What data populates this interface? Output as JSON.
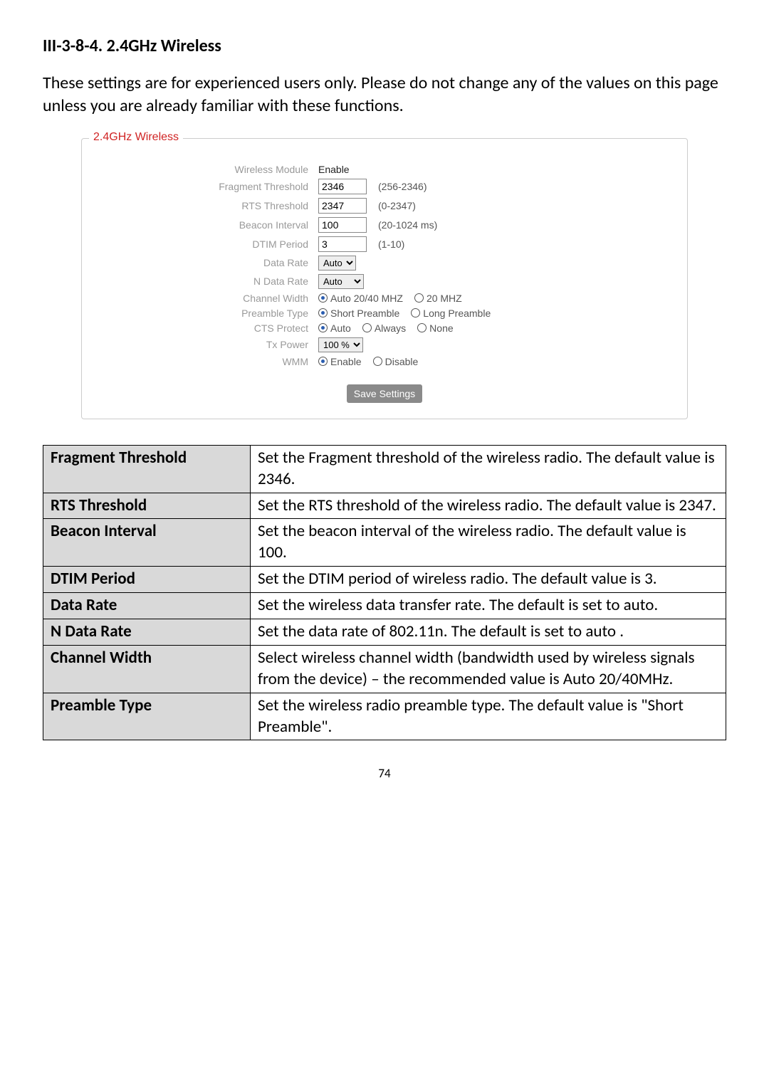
{
  "section_title": "III-3-8-4.    2.4GHz Wireless",
  "intro_text": "These settings are for experienced users only. Please do not change any of the values on this page unless you are already familiar with these functions.",
  "legend": "2.4GHz Wireless",
  "fields": {
    "wireless_module": {
      "label": "Wireless Module",
      "value": "Enable"
    },
    "fragment_threshold": {
      "label": "Fragment Threshold",
      "value": "2346",
      "range": "(256-2346)"
    },
    "rts_threshold": {
      "label": "RTS Threshold",
      "value": "2347",
      "range": "(0-2347)"
    },
    "beacon_interval": {
      "label": "Beacon Interval",
      "value": "100",
      "range": "(20-1024 ms)"
    },
    "dtim_period": {
      "label": "DTIM Period",
      "value": "3",
      "range": "(1-10)"
    },
    "data_rate": {
      "label": "Data Rate",
      "value": "Auto"
    },
    "n_data_rate": {
      "label": "N Data Rate",
      "value": "Auto"
    },
    "channel_width": {
      "label": "Channel Width",
      "opt1": "Auto 20/40 MHZ",
      "opt2": "20 MHZ"
    },
    "preamble_type": {
      "label": "Preamble Type",
      "opt1": "Short Preamble",
      "opt2": "Long Preamble"
    },
    "cts_protect": {
      "label": "CTS Protect",
      "opt1": "Auto",
      "opt2": "Always",
      "opt3": "None"
    },
    "tx_power": {
      "label": "Tx Power",
      "value": "100 %"
    },
    "wmm": {
      "label": "WMM",
      "opt1": "Enable",
      "opt2": "Disable"
    }
  },
  "save_label": "Save Settings",
  "desc_rows": [
    {
      "name": "Fragment Threshold",
      "desc": "Set the Fragment threshold of the wireless radio. The default value is 2346."
    },
    {
      "name": "RTS Threshold",
      "desc": "Set the RTS threshold of the wireless radio. The default value is 2347."
    },
    {
      "name": "Beacon Interval",
      "desc": "Set the beacon interval of the wireless radio. The default value is 100."
    },
    {
      "name": "DTIM Period",
      "desc": "Set the DTIM period of wireless radio. The default value is 3."
    },
    {
      "name": "Data Rate",
      "desc": "Set the wireless data transfer rate. The default is set to auto."
    },
    {
      "name": "N Data Rate",
      "desc": "Set the data rate of 802.11n. The default is set to auto ."
    },
    {
      "name": "Channel Width",
      "desc": "Select wireless channel width (bandwidth used by wireless signals from the device) – the recommended value is Auto 20/40MHz."
    },
    {
      "name": "Preamble Type",
      "desc": "Set the wireless radio preamble type. The default value is \"Short Preamble\"."
    }
  ],
  "page_number": "74"
}
